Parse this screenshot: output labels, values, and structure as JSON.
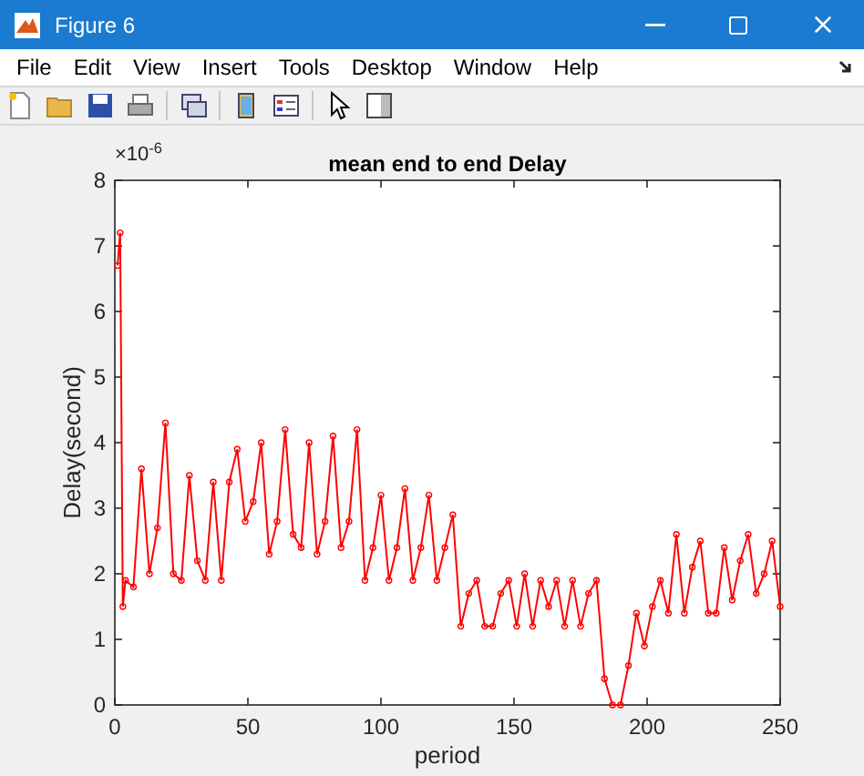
{
  "window": {
    "title": "Figure 6"
  },
  "menu": [
    "File",
    "Edit",
    "View",
    "Insert",
    "Tools",
    "Desktop",
    "Window",
    "Help"
  ],
  "axes": {
    "multiplier": "×10$^{-6}$",
    "chart_data": {
      "type": "line",
      "title": "mean end to end Delay",
      "xlabel": "period",
      "ylabel": "Delay(second)",
      "xlim": [
        0,
        250
      ],
      "ylim": [
        0,
        8
      ],
      "xticks": [
        0,
        50,
        100,
        150,
        200,
        250
      ],
      "yticks": [
        0,
        1,
        2,
        3,
        4,
        5,
        6,
        7,
        8
      ],
      "x": [
        1,
        2,
        3,
        4,
        7,
        10,
        13,
        16,
        19,
        22,
        25,
        28,
        31,
        34,
        37,
        40,
        43,
        46,
        49,
        52,
        55,
        58,
        61,
        64,
        67,
        70,
        73,
        76,
        79,
        82,
        85,
        88,
        91,
        94,
        97,
        100,
        103,
        106,
        109,
        112,
        115,
        118,
        121,
        124,
        127,
        130,
        133,
        136,
        139,
        142,
        145,
        148,
        151,
        154,
        157,
        160,
        163,
        166,
        169,
        172,
        175,
        178,
        181,
        184,
        187,
        190,
        193,
        196,
        199,
        202,
        205,
        208,
        211,
        214,
        217,
        220,
        223,
        226,
        229,
        232,
        235,
        238,
        241,
        244,
        247,
        250
      ],
      "series": [
        {
          "color": "#ff0000",
          "marker": "o",
          "values": [
            6.7,
            7.2,
            1.5,
            1.9,
            1.8,
            3.6,
            2.0,
            2.7,
            4.3,
            2.0,
            1.9,
            3.5,
            2.2,
            1.9,
            3.4,
            1.9,
            3.4,
            3.9,
            2.8,
            3.1,
            4.0,
            2.3,
            2.8,
            4.2,
            2.6,
            2.4,
            4.0,
            2.3,
            2.8,
            4.1,
            2.4,
            2.8,
            4.2,
            1.9,
            2.4,
            3.2,
            1.9,
            2.4,
            3.3,
            1.9,
            2.4,
            3.2,
            1.9,
            2.4,
            2.9,
            1.2,
            1.7,
            1.9,
            1.2,
            1.2,
            1.7,
            1.9,
            1.2,
            2.0,
            1.2,
            1.9,
            1.5,
            1.9,
            1.2,
            1.9,
            1.2,
            1.7,
            1.9,
            0.4,
            0.0,
            0.0,
            0.6,
            1.4,
            0.9,
            1.5,
            1.9,
            1.4,
            2.6,
            1.4,
            2.1,
            2.5,
            1.4,
            1.4,
            2.4,
            1.6,
            2.2,
            2.6,
            1.7,
            2.0,
            2.5,
            1.5
          ]
        }
      ]
    }
  }
}
